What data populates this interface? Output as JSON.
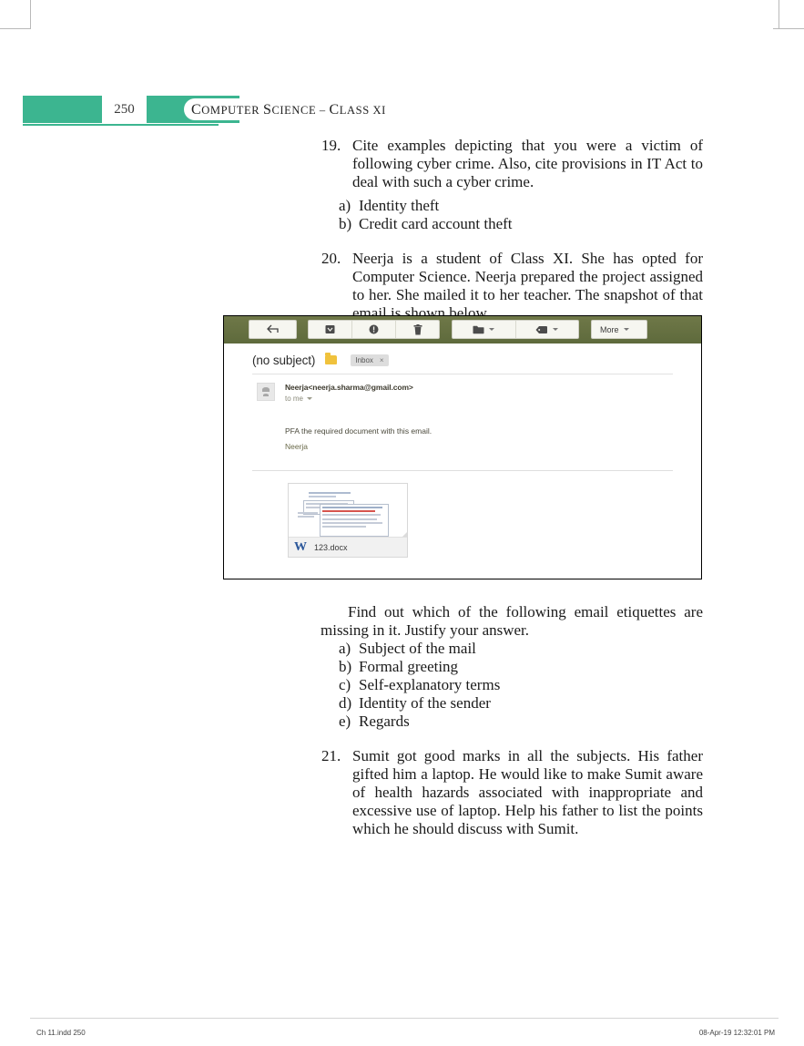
{
  "page": {
    "number": "250",
    "running_head": "Computer Science – Class XI",
    "accent_color": "#3cb590"
  },
  "questions": [
    {
      "number": "19.",
      "text": "Cite examples depicting that you were a victim of following cyber crime. Also, cite provisions in IT Act to deal with such a cyber crime.",
      "options": [
        {
          "label": "a)",
          "text": "Identity theft"
        },
        {
          "label": "b)",
          "text": "Credit card account theft"
        }
      ]
    },
    {
      "number": "20.",
      "text": "Neerja is a student of Class XI. She has opted for Computer Science. Neerja prepared the project assigned to her. She mailed it to her teacher. The snapshot of that email is shown below.",
      "options": []
    },
    {
      "number": "21.",
      "text": "Sumit got good marks in all the subjects. His father gifted him a laptop. He would like to make Sumit aware of health hazards associated with inappropriate and excessive use of laptop. Help his father to list the points which he should discuss with Sumit.",
      "options": []
    }
  ],
  "followup": {
    "paragraph": "Find out which of the following email etiquettes are missing in it. Justify your answer.",
    "options": [
      {
        "label": "a)",
        "text": "Subject of the mail"
      },
      {
        "label": "b)",
        "text": "Formal greeting"
      },
      {
        "label": "c)",
        "text": "Self-explanatory terms"
      },
      {
        "label": "d)",
        "text": "Identity of the sender"
      },
      {
        "label": "e)",
        "text": "Regards"
      }
    ]
  },
  "email_screenshot": {
    "toolbar": {
      "back_icon": "back-arrow-icon",
      "archive_icon": "archive-icon",
      "spam_icon": "report-spam-icon",
      "delete_icon": "trash-icon",
      "move_icon": "move-to-folder-icon",
      "labels_icon": "labels-tag-icon",
      "more_label": "More"
    },
    "subject": "(no subject)",
    "folder_icon": "folder-icon",
    "label_chip": "Inbox",
    "label_chip_remove": "×",
    "sender": "Neerja<neerja.sharma@gmail.com>",
    "recipient": "to me",
    "body": "PFA the required document with this email.",
    "signature": "Neerja",
    "attachment": {
      "name": "123.docx",
      "type_icon": "word-document-icon",
      "type_letter": "W"
    }
  },
  "footer": {
    "left": "Ch 11.indd   250",
    "right": "08-Apr-19   12:32:01 PM"
  }
}
